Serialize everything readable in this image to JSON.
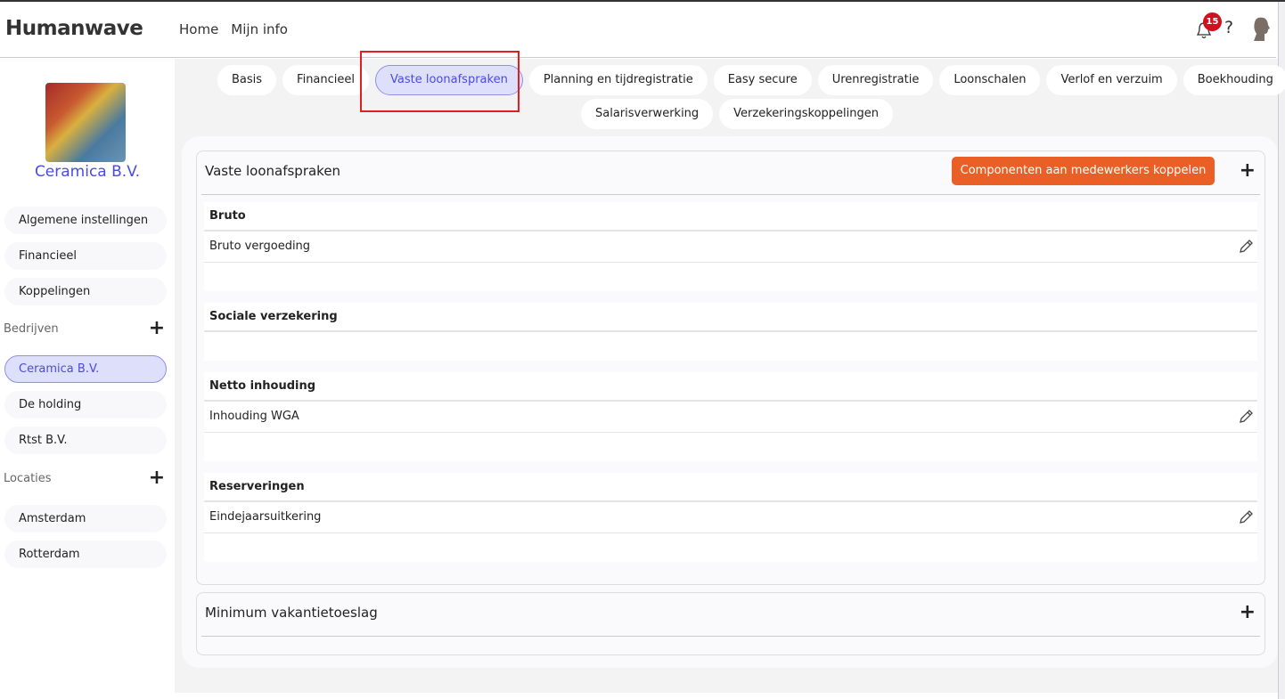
{
  "header": {
    "logo": "Humanwave",
    "nav": [
      "Home",
      "Mijn info"
    ],
    "notification_count": "15",
    "help": "?"
  },
  "sidebar": {
    "company_name": "Ceramica B.V.",
    "items": [
      "Algemene instellingen",
      "Financieel",
      "Koppelingen"
    ],
    "bedrijven_label": "Bedrijven",
    "bedrijven": [
      "Ceramica B.V.",
      "De holding",
      "Rtst B.V."
    ],
    "locaties_label": "Locaties",
    "locaties": [
      "Amsterdam",
      "Rotterdam"
    ],
    "plus": "+"
  },
  "tabs": {
    "row1": [
      "Basis",
      "Financieel",
      "Vaste loonafspraken",
      "Planning en tijdregistratie",
      "Easy secure",
      "Urenregistratie",
      "Loonschalen",
      "Verlof en verzuim",
      "Boekhouding"
    ],
    "row2": [
      "Salarisverwerking",
      "Verzekeringskoppelingen"
    ],
    "active": "Vaste loonafspraken"
  },
  "main": {
    "card1": {
      "title": "Vaste loonafspraken",
      "button": "Componenten aan medewerkers koppelen",
      "plus": "+",
      "sections": [
        {
          "title": "Bruto",
          "items": [
            "Bruto vergoeding"
          ]
        },
        {
          "title": "Sociale verzekering",
          "items": []
        },
        {
          "title": "Netto inhouding",
          "items": [
            "Inhouding WGA"
          ]
        },
        {
          "title": "Reserveringen",
          "items": [
            "Eindejaarsuitkering"
          ]
        }
      ]
    },
    "card2": {
      "title": "Minimum vakantietoeslag",
      "plus": "+"
    }
  },
  "colors": {
    "accent": "#4a4ae8",
    "orange": "#e95f25",
    "badge": "#d0101e"
  }
}
